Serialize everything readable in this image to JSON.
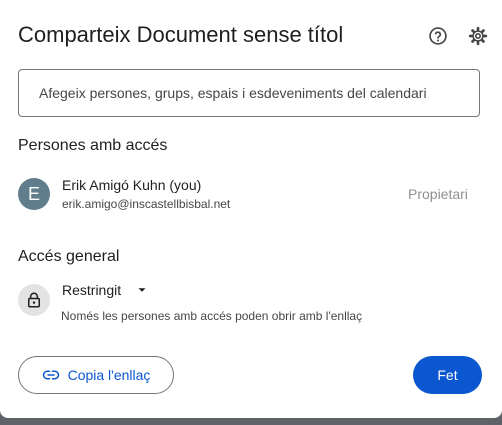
{
  "dialog": {
    "title": "Comparteix Document sense títol"
  },
  "add_people": {
    "placeholder": "Afegeix persones, grups, espais i esdeveniments del calendari"
  },
  "people_with_access": {
    "heading": "Persones amb accés",
    "people": [
      {
        "initial": "E",
        "name": "Erik Amigó Kuhn (you)",
        "email": "erik.amigo@inscastellbisbal.net",
        "role": "Propietari"
      }
    ]
  },
  "general_access": {
    "heading": "Accés general",
    "mode": "Restringit",
    "description": "Només les persones amb accés poden obrir amb l'enllaç"
  },
  "footer": {
    "copy_link_label": "Copia l'enllaç",
    "done_label": "Fet"
  },
  "colors": {
    "accent": "#0b57d0",
    "avatar": "#607d8b",
    "overlay": "#5f6368"
  },
  "icons": {
    "help": "help-circle-icon",
    "settings": "gear-icon",
    "lock": "lock-icon",
    "dropdown": "caret-down-icon",
    "link": "link-icon"
  }
}
